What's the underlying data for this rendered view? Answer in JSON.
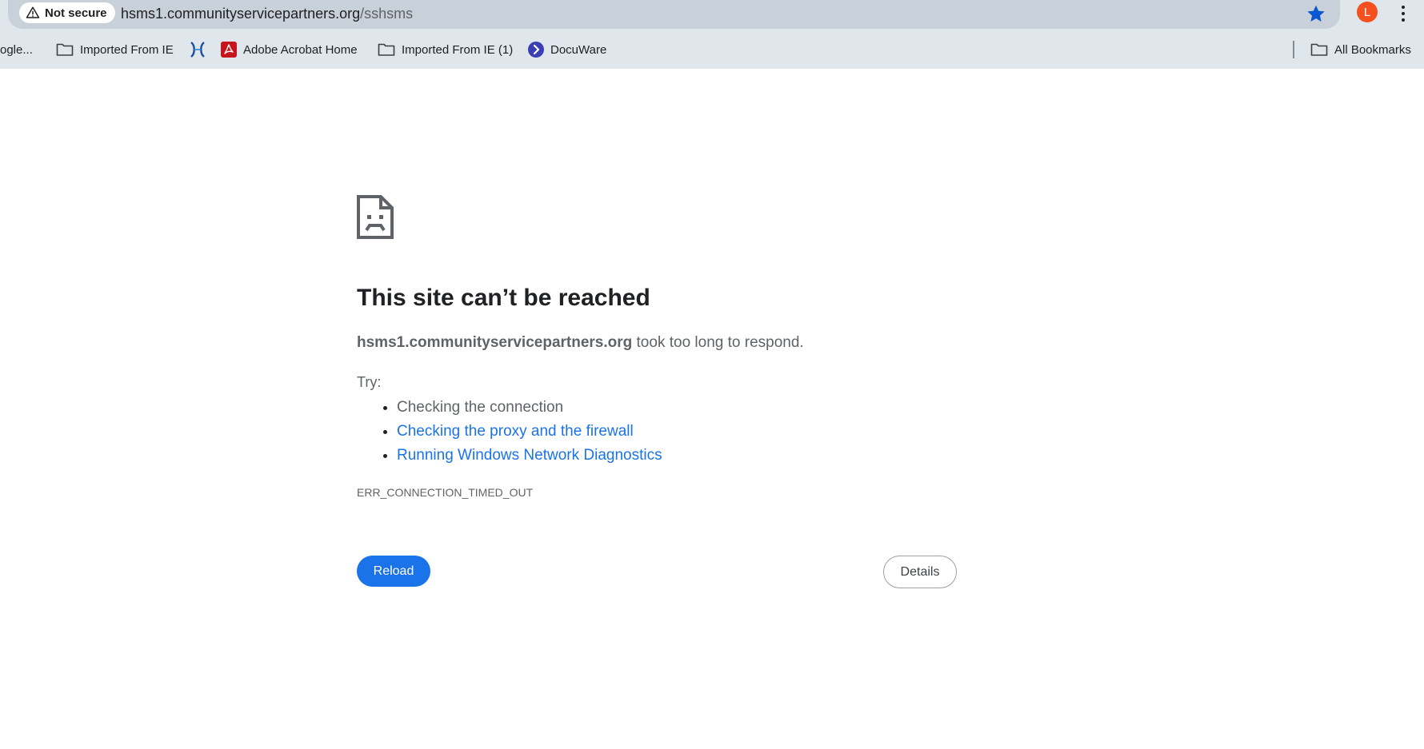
{
  "address_bar": {
    "security_label": "Not secure",
    "url_host": "hsms1.communityservicepartners.org",
    "url_path": "/sshsms",
    "profile_initial": "L"
  },
  "bookmarks": {
    "items": [
      {
        "label": "ogle..."
      },
      {
        "label": "Imported From IE"
      },
      {
        "label": ""
      },
      {
        "label": "Adobe Acrobat Home"
      },
      {
        "label": "Imported From IE (1)"
      },
      {
        "label": "DocuWare"
      }
    ],
    "all_bookmarks_label": "All Bookmarks"
  },
  "error_page": {
    "title": "This site can’t be reached",
    "host": "hsms1.communityservicepartners.org",
    "message": " took too long to respond.",
    "try_label": "Try:",
    "suggestions": [
      {
        "text": "Checking the connection"
      },
      {
        "text": "Checking the proxy and the firewall"
      },
      {
        "text": "Running Windows Network Diagnostics"
      }
    ],
    "error_code": "ERR_CONNECTION_TIMED_OUT",
    "reload_label": "Reload",
    "details_label": "Details"
  },
  "colors": {
    "accent": "#1a73e8",
    "toolbar_bg": "#dfe6ec",
    "omnibox_bg": "#c8d1d9",
    "star": "#0b57d0",
    "avatar": "#f4511e",
    "acrobat_red": "#c4161c",
    "docuware_blue": "#3b3fb6"
  },
  "icons": {
    "security": "warning-triangle-icon",
    "star": "star-icon",
    "menu": "three-dot-menu-icon",
    "folder": "folder-icon",
    "acrobat": "adobe-acrobat-icon",
    "docuware": "docuware-icon",
    "error": "sad-page-icon"
  }
}
